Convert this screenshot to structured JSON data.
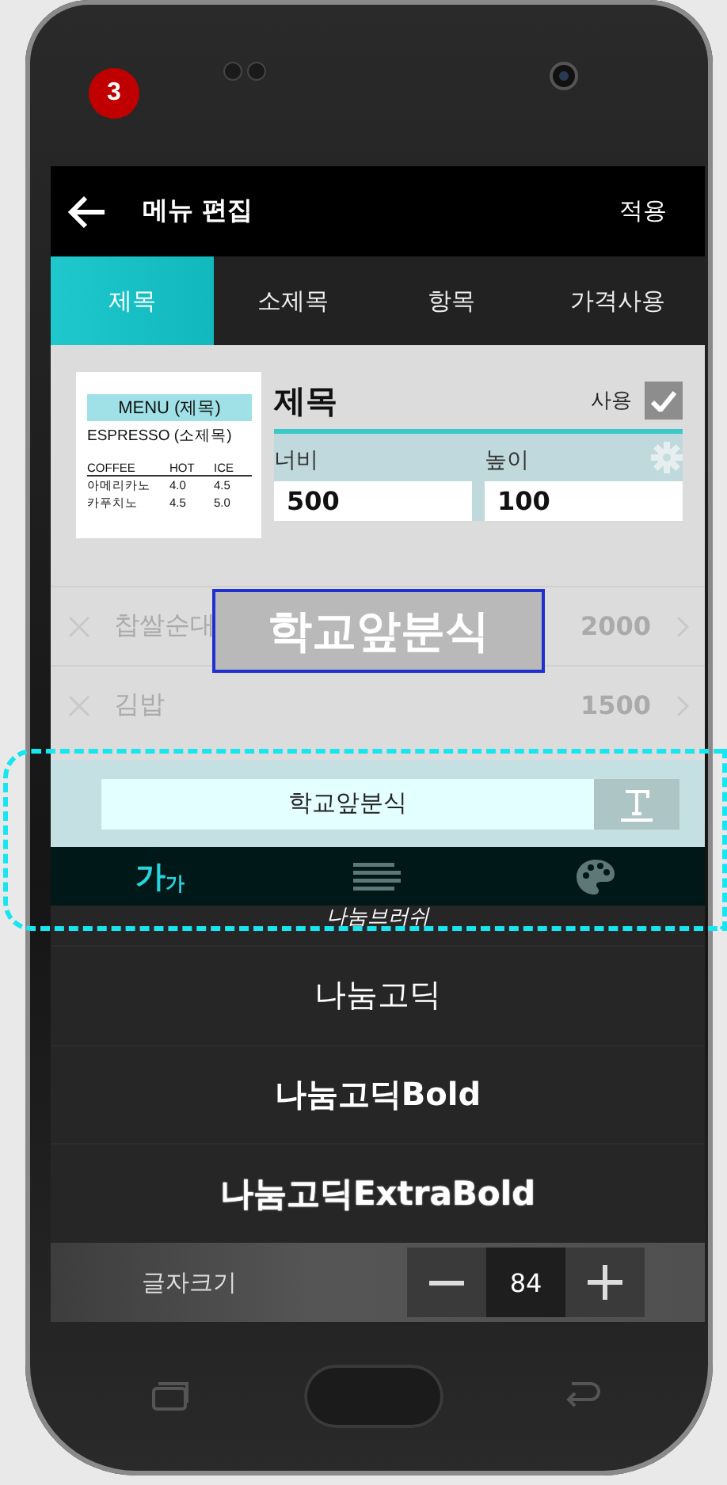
{
  "badge": "3",
  "header": {
    "title": "메뉴 편집",
    "action": "적용"
  },
  "tabs": [
    {
      "label": "제목",
      "selected": true
    },
    {
      "label": "소제목",
      "selected": false
    },
    {
      "label": "항목",
      "selected": false
    },
    {
      "label": "가격사용",
      "selected": false
    }
  ],
  "background_list": [
    {
      "name": "찹쌀순대",
      "price": "2000"
    },
    {
      "name": "김밥",
      "price": "1500"
    }
  ],
  "preview_card": {
    "title": "MENU (제목)",
    "subtitle": "ESPRESSO (소제목)",
    "columns": [
      "COFFEE",
      "HOT",
      "ICE"
    ],
    "rows": [
      [
        "아메리카노",
        "4.0",
        "4.5"
      ],
      [
        "카푸치노",
        "4.5",
        "5.0"
      ]
    ]
  },
  "editor": {
    "heading": "제목",
    "use_label": "사용",
    "use_checked": true,
    "width_label": "너비",
    "width_value": "500",
    "height_label": "높이",
    "height_value": "100"
  },
  "title_preview": "학교앞분식",
  "text_field": {
    "value": "학교앞분식"
  },
  "tools": [
    {
      "kind": "font",
      "label": "가",
      "sublabel": "가",
      "selected": true
    },
    {
      "kind": "align",
      "selected": false
    },
    {
      "kind": "palette",
      "selected": false
    }
  ],
  "fonts": [
    {
      "name": "나눔브러쉬",
      "kind": "brush"
    },
    {
      "name": "나눔고딕",
      "kind": "regular"
    },
    {
      "name": "나눔고딕Bold",
      "kind": "bold"
    },
    {
      "name": "나눔고딕ExtraBold",
      "kind": "extrabold"
    }
  ],
  "font_size": {
    "label": "글자크기",
    "value": "84"
  }
}
